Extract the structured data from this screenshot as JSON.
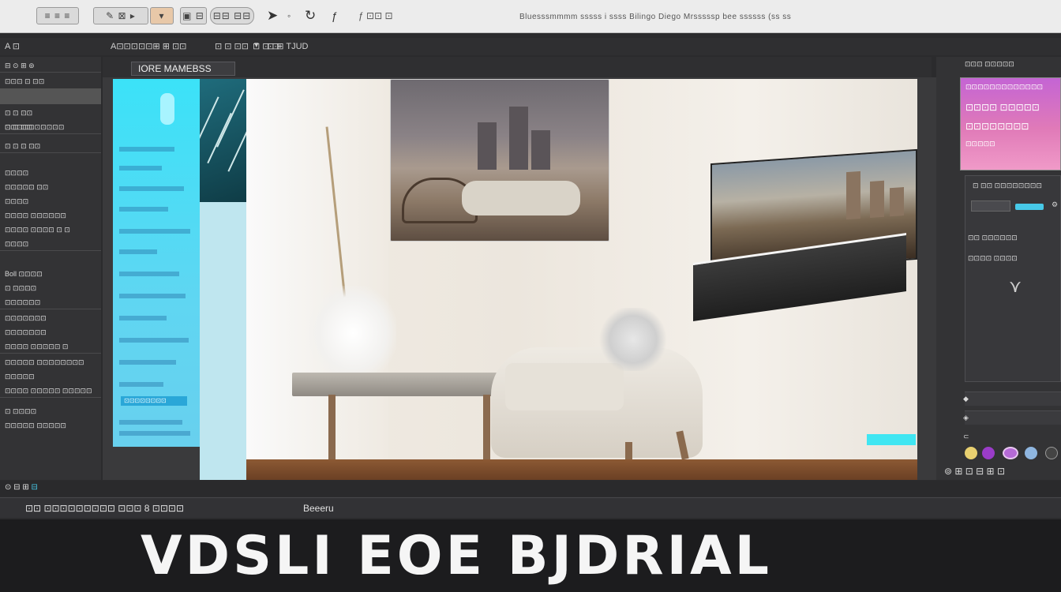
{
  "topbar": {
    "buttons": [
      "≡ ≡ ≡",
      "✎ ⊠ ▸",
      "▾",
      "▣ ⊟",
      "⊟⊟ ⊟⊟"
    ],
    "icons": [
      "pointer-icon",
      "dot-icon",
      "refresh-icon",
      "text-tool-icon"
    ],
    "tool_text": "ƒ ⊡⊡ ⊡",
    "menu": "Bluesssmmmm  sssss  i  ssss  Bilingo  Diego  Mrsssssp  bee  ssssss  (ss  ss"
  },
  "toolrow": {
    "items": [
      "A ⊡",
      "A⊡⊡⊡⊡⊡⊞ ⊞ ⊡⊡",
      "⊡ ⊡ ⊡⊡",
      "⊡ ⊡ ⊡",
      "▾",
      "⊡ ⊞ TJUD"
    ]
  },
  "sidebar": {
    "rows": [
      "⊟ ⊙ ⊞ ⊚",
      "⊡⊡⊡ ⊡ ⊡⊡",
      "",
      "⊡ ⊡ ⊡⊡",
      "⊡⊡⊡⊡⊡",
      "",
      "⊡ ⊡ ⊡⊡ ⊡⊡⊡⊡⊡",
      "⊡ ⊡ ⊡ ⊡⊡",
      "",
      "⊡⊡⊡⊡",
      "⊡⊡⊡⊡⊡  ⊡⊡",
      "⊡⊡⊡⊡",
      "⊡⊡⊡⊡  ⊡⊡⊡⊡⊡⊡",
      "⊡⊡⊡⊡ ⊡⊡⊡⊡ ⊡ ⊡",
      "⊡⊡⊡⊡",
      "Boll ⊡⊡⊡⊡",
      "⊡ ⊡⊡⊡⊡",
      "⊡⊡⊡⊡⊡⊡",
      "⊡⊡⊡⊡⊡⊡⊡",
      "⊡⊡⊡⊡⊡⊡⊡",
      "⊡⊡⊡⊡ ⊡⊡⊡⊡⊡ ⊡",
      "⊡⊡⊡⊡⊡ ⊡⊡⊡⊡⊡⊡⊡⊡",
      "⊡⊡⊡⊡⊡",
      "⊡⊡⊡⊡  ⊡⊡⊡⊡⊡  ⊡⊡⊡⊡⊡",
      "⊡ ⊡⊡⊡⊡",
      "⊡⊡⊡⊡⊡ ⊡⊡⊡⊡⊡"
    ]
  },
  "canvas": {
    "tab_label": "IORE  MAMEBSS",
    "overlay_label": "⊡⊡⊡⊡⊡⊡⊡⊡"
  },
  "right_panel": {
    "top_label": "⊡⊡⊡  ⊡⊡⊡⊡⊡",
    "head_lines": [
      "⊡⊡⊡⊡⊡⊡⊡⊡⊡⊡⊡⊡⊡",
      "⊡⊡⊡⊡ ⊡⊡⊡⊡⊡",
      "⊡⊡⊡⊡⊡⊡⊡⊡",
      "⊡⊡⊡⊡⊡"
    ],
    "box_title": "⊡ ⊡⊡ ⊡⊡⊡⊡⊡⊡⊡⊡",
    "box_row2": "⊡⊡  ⊡⊡⊡⊡⊡⊡",
    "box_row3": "⊡⊡⊡⊡ ⊡⊡⊡⊡",
    "swatch_colors": [
      "#e8d070",
      "#9a3cc8",
      "#b56ad6",
      "#8fb6e0",
      "#444444"
    ]
  },
  "bottom_bar": {
    "left_text": "⊡⊡  ⊡⊡⊡⊡⊡⊡⊡⊡⊡ ⊡⊡⊡  8  ⊡⊡⊡⊡",
    "right_text": "Beeeru"
  },
  "banner": {
    "title": "VDSLI EOE BJDRIAL"
  }
}
